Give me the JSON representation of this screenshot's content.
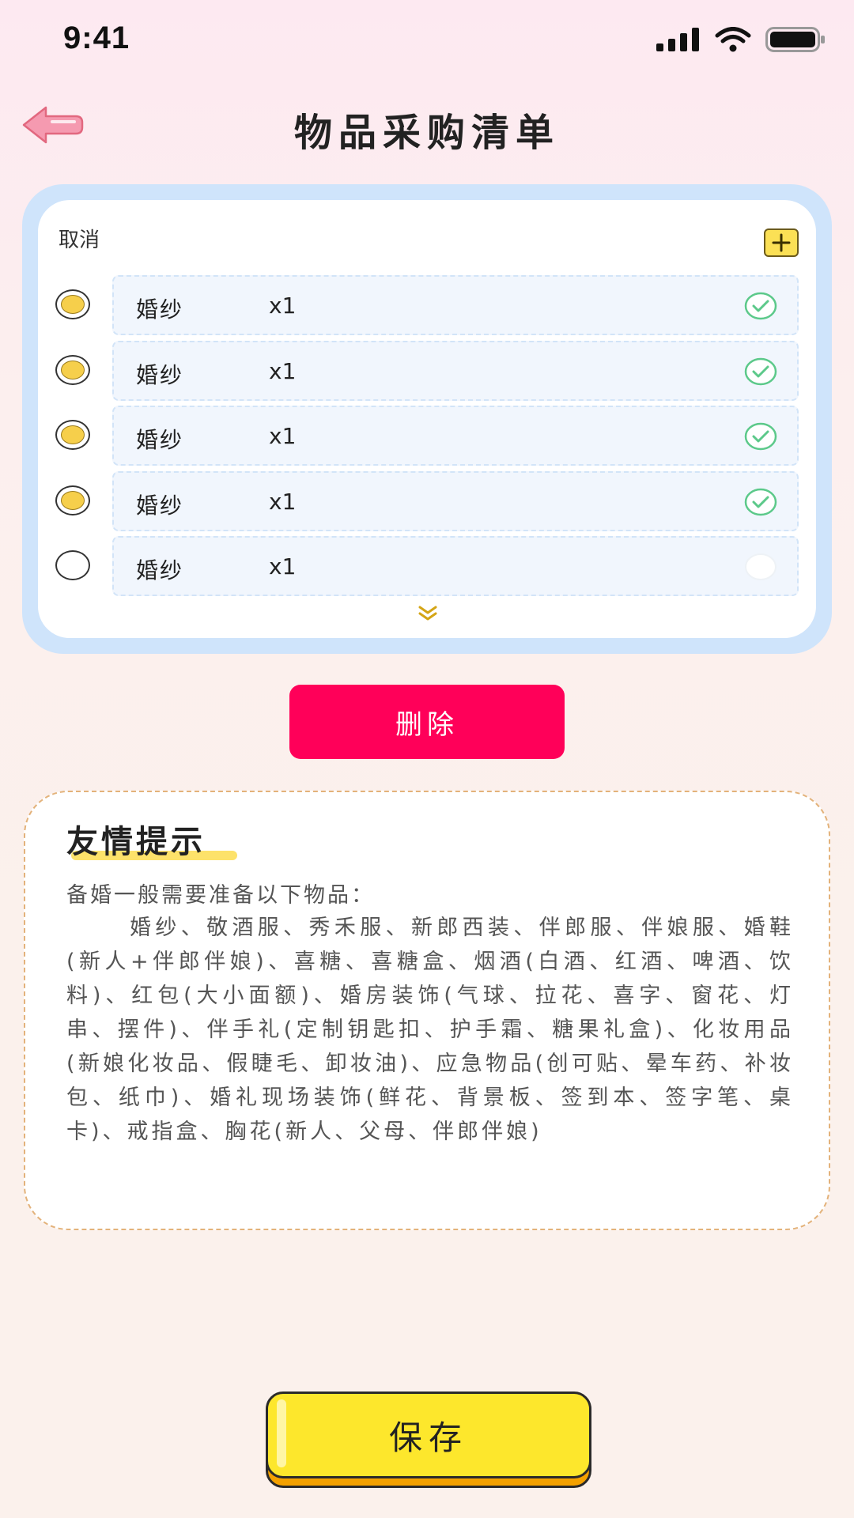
{
  "status_bar": {
    "time": "9:41"
  },
  "header": {
    "title": "物品采购清单"
  },
  "list": {
    "cancel_label": "取消",
    "items": [
      {
        "name": "婚纱",
        "qty": "x1",
        "selected": true,
        "checked": true
      },
      {
        "name": "婚纱",
        "qty": "x1",
        "selected": true,
        "checked": true
      },
      {
        "name": "婚纱",
        "qty": "x1",
        "selected": true,
        "checked": true
      },
      {
        "name": "婚纱",
        "qty": "x1",
        "selected": true,
        "checked": true
      },
      {
        "name": "婚纱",
        "qty": "x1",
        "selected": false,
        "checked": false
      }
    ]
  },
  "delete_label": "删除",
  "tip": {
    "title": "友情提示",
    "intro": "备婚一般需要准备以下物品：",
    "body": "婚纱、敬酒服、秀禾服、新郎西装、伴郎服、伴娘服、婚鞋(新人+伴郎伴娘)、喜糖、喜糖盒、烟酒(白酒、红酒、啤酒、饮料)、红包(大小面额)、婚房装饰(气球、拉花、喜字、窗花、灯串、摆件)、伴手礼(定制钥匙扣、护手霜、糖果礼盒)、化妆用品(新娘化妆品、假睫毛、卸妆油)、应急物品(创可贴、晕车药、补妆包、纸巾)、婚礼现场装饰(鲜花、背景板、签到本、签字笔、桌卡)、戒指盒、胸花(新人、父母、伴郎伴娘)"
  },
  "save_label": "保存",
  "colors": {
    "accent_red": "#ff0059",
    "save_yellow": "#fde72c",
    "check_green": "#5cc98a",
    "list_border_blue": "#cfe4fb",
    "tip_border": "#e3b27a"
  }
}
